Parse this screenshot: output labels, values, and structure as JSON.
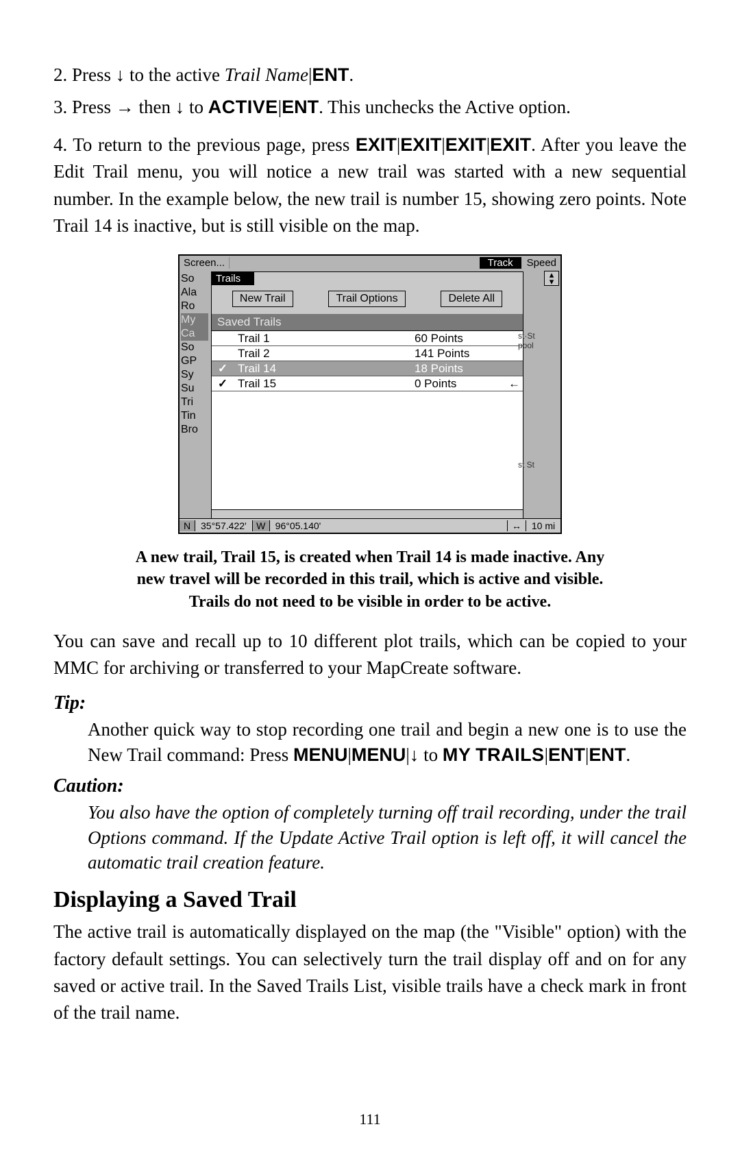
{
  "step2_prefix": "2. Press ↓ to the active ",
  "step2_italic": "Trail Name",
  "pipe": "|",
  "ent": "ENT",
  "period": ".",
  "step3_a": "3. Press → then ↓ to ",
  "active_sc": "ACTIVE",
  "step3_b": ". This unchecks the Active option.",
  "step4_a": "4. To return to the previous page, press ",
  "exit": "EXIT",
  "step4_b": ". After you leave the Edit Trail menu, you will notice a new trail was started with a new sequential number. In the example below, the new trail is number 15, showing zero points. Note Trail 14 is inactive, but is still visible on the map.",
  "screenshot": {
    "top": {
      "screen": "Screen...",
      "track": "Track",
      "speed": "Speed"
    },
    "sidebar": [
      "So",
      "Ala",
      "Ro",
      "My",
      "Ca",
      "So",
      "GP",
      "Sy",
      "Su",
      "Tri",
      "Tin",
      "Bro"
    ],
    "sidebar_hi_index": 3,
    "trails_title": "Trails",
    "buttons": {
      "new": "New Trail",
      "options": "Trail Options",
      "delete": "Delete All"
    },
    "saved_header": "Saved Trails",
    "rows": [
      {
        "check": "",
        "name": "Trail 1",
        "pts": "60 Points",
        "sel": false,
        "arrow": ""
      },
      {
        "check": "",
        "name": "Trail 2",
        "pts": "141 Points",
        "sel": false,
        "arrow": ""
      },
      {
        "check": "✓",
        "name": "Trail 14",
        "pts": "18 Points",
        "sel": true,
        "arrow": ""
      },
      {
        "check": "✓",
        "name": "Trail 15",
        "pts": "0 Points",
        "sel": false,
        "arrow": "←"
      }
    ],
    "right_labels": [
      "st·St",
      "pool",
      "",
      "",
      "st St"
    ],
    "status": {
      "n": "N",
      "lat": "35°57.422'",
      "w": "W",
      "lon": "96°05.140'",
      "arr": "↔",
      "scale": "10 mi"
    }
  },
  "caption_l1": "A new trail, Trail 15, is created when Trail 14 is made inactive. Any",
  "caption_l2": "new travel will be recorded in this trail, which is active and visible.",
  "caption_l3": "Trails do not need to be visible in order to be active.",
  "para_after": "You can save and recall up to 10 different plot trails, which can be copied to your MMC for archiving or transferred to your MapCreate software.",
  "tip_label": "Tip:",
  "tip_a": "Another quick way to stop recording one trail and begin a new one is to use the New Trail command: Press ",
  "menu": "MENU",
  "tip_b": "↓ to ",
  "my_sc": "MY",
  "trails_sc": "TRAILS",
  "caution_label": "Caution:",
  "caution_body": "You also have the option of completely turning off trail recording, under the trail Options command. If the Update Active Trail option is left off, it will cancel the automatic trail creation feature.",
  "section_heading": "Displaying a Saved Trail",
  "section_body": "The active trail is automatically displayed on the map (the \"Visible\" option) with the factory default settings. You can selectively turn the trail display off and on for any saved or active trail. In the Saved Trails List, visible trails have a check mark in front of the trail name.",
  "page_num": "111"
}
